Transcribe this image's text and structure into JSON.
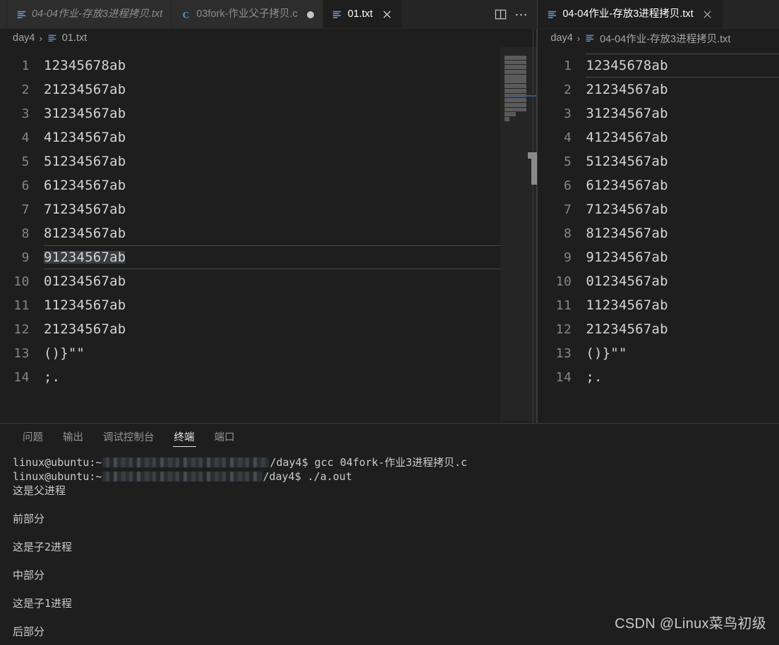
{
  "theme": {
    "editor_bg": "#1e1e1e",
    "tabbar_bg": "#252526",
    "inactive_tab_bg": "#2d2d2d",
    "text": "#d4d4d4",
    "line_number": "#858585",
    "accent_blue": "#3b5a80",
    "selection": "#3a3d41"
  },
  "left_group": {
    "tabs": [
      {
        "label": "",
        "icon": "partial-tab-icon",
        "state": "partial",
        "italic": false
      },
      {
        "label": "04-04作业-存放3进程拷贝.txt",
        "icon": "text-file-icon",
        "state": "inactive-preview",
        "italic": true
      },
      {
        "label": "03fork-作业父子拷贝.c",
        "icon": "c-file-icon",
        "state": "inactive-dirty",
        "italic": false
      },
      {
        "label": "01.txt",
        "icon": "text-file-icon",
        "state": "active",
        "italic": false
      }
    ],
    "actions": [
      {
        "name": "split-editor-icon",
        "label": "⫿⫿"
      },
      {
        "name": "more-actions-icon",
        "label": "···"
      }
    ],
    "breadcrumb": {
      "folder": "day4",
      "separator": "›",
      "file": "01.txt",
      "file_icon": "text-file-icon"
    },
    "editor": {
      "file": "01.txt",
      "cursor_line": 9,
      "selection": {
        "line": 9,
        "text": "91234567ab"
      },
      "lines": [
        {
          "n": 1,
          "text": "12345678ab"
        },
        {
          "n": 2,
          "text": "21234567ab"
        },
        {
          "n": 3,
          "text": "31234567ab"
        },
        {
          "n": 4,
          "text": "41234567ab"
        },
        {
          "n": 5,
          "text": "51234567ab"
        },
        {
          "n": 6,
          "text": "61234567ab"
        },
        {
          "n": 7,
          "text": "71234567ab"
        },
        {
          "n": 8,
          "text": "81234567ab"
        },
        {
          "n": 9,
          "text": "91234567ab"
        },
        {
          "n": 10,
          "text": "01234567ab"
        },
        {
          "n": 11,
          "text": "11234567ab"
        },
        {
          "n": 12,
          "text": "21234567ab"
        },
        {
          "n": 13,
          "text": "()}\"\""
        },
        {
          "n": 14,
          "text": ";."
        }
      ]
    }
  },
  "right_group": {
    "tabs": [
      {
        "label": "04-04作业-存放3进程拷贝.txt",
        "icon": "text-file-icon",
        "state": "active",
        "italic": false
      }
    ],
    "breadcrumb": {
      "folder": "day4",
      "separator": "›",
      "file": "04-04作业-存放3进程拷贝.txt",
      "file_icon": "text-file-icon"
    },
    "editor": {
      "file": "04-04作业-存放3进程拷贝.txt",
      "cursor_line": 1,
      "lines": [
        {
          "n": 1,
          "text": "12345678ab"
        },
        {
          "n": 2,
          "text": "21234567ab"
        },
        {
          "n": 3,
          "text": "31234567ab"
        },
        {
          "n": 4,
          "text": "41234567ab"
        },
        {
          "n": 5,
          "text": "51234567ab"
        },
        {
          "n": 6,
          "text": "61234567ab"
        },
        {
          "n": 7,
          "text": "71234567ab"
        },
        {
          "n": 8,
          "text": "81234567ab"
        },
        {
          "n": 9,
          "text": "91234567ab"
        },
        {
          "n": 10,
          "text": "01234567ab"
        },
        {
          "n": 11,
          "text": "11234567ab"
        },
        {
          "n": 12,
          "text": "21234567ab"
        },
        {
          "n": 13,
          "text": "()}\"\""
        },
        {
          "n": 14,
          "text": ";."
        }
      ]
    }
  },
  "panel": {
    "tabs": [
      {
        "label": "问题",
        "active": false
      },
      {
        "label": "输出",
        "active": false
      },
      {
        "label": "调试控制台",
        "active": false
      },
      {
        "label": "终端",
        "active": true
      },
      {
        "label": "端口",
        "active": false
      }
    ],
    "terminal": {
      "lines": [
        {
          "type": "prompt",
          "user": "linux@ubuntu:~",
          "redacted": true,
          "redact_width": 236,
          "path": "/day4$",
          "command": " gcc 04fork-作业3进程拷贝.c"
        },
        {
          "type": "prompt",
          "user": "linux@ubuntu:~",
          "redacted": true,
          "redact_width": 226,
          "path": "/day4$",
          "command": " ./a.out"
        },
        {
          "type": "output",
          "text": "这是父进程"
        },
        {
          "type": "blank",
          "text": ""
        },
        {
          "type": "output",
          "text": "前部分"
        },
        {
          "type": "blank",
          "text": ""
        },
        {
          "type": "output",
          "text": "这是子2进程"
        },
        {
          "type": "blank",
          "text": ""
        },
        {
          "type": "output",
          "text": "中部分"
        },
        {
          "type": "blank",
          "text": ""
        },
        {
          "type": "output",
          "text": "这是子1进程"
        },
        {
          "type": "blank",
          "text": ""
        },
        {
          "type": "output",
          "text": "后部分"
        }
      ]
    }
  },
  "watermark": "CSDN @Linux菜鸟初级"
}
